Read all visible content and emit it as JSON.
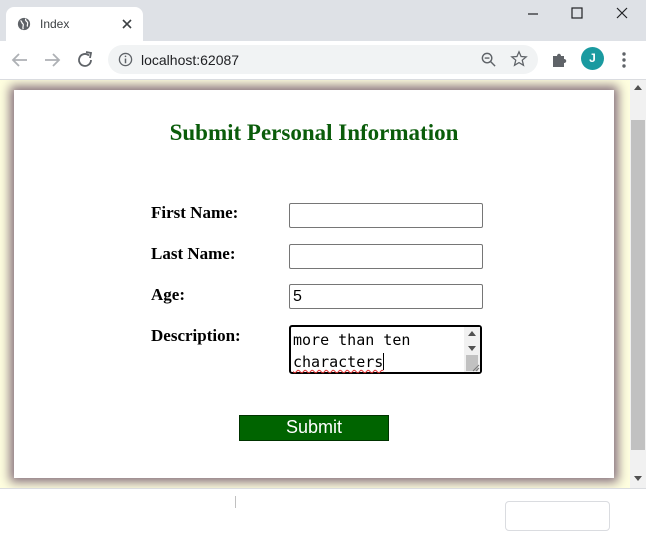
{
  "browser": {
    "tab": {
      "title": "Index",
      "favicon": "globe-icon"
    },
    "window_controls": [
      "minimize-icon",
      "maximize-icon",
      "close-icon"
    ],
    "address_bar": {
      "url": "localhost:62087",
      "security_icon": "info-icon"
    },
    "profile_initial": "J",
    "accent_color": "#1a9aa0"
  },
  "page": {
    "background_color": "#ffffe0",
    "title": "Submit Personal Information",
    "title_color": "#0a5c0a",
    "fields": {
      "first_name": {
        "label": "First Name:",
        "value": ""
      },
      "last_name": {
        "label": "Last Name:",
        "value": ""
      },
      "age": {
        "label": "Age:",
        "value": "5"
      },
      "description": {
        "label": "Description:",
        "value_line1": "more than ten",
        "value_line2": "characters"
      }
    },
    "submit": {
      "label": "Submit",
      "color": "#006400"
    }
  }
}
